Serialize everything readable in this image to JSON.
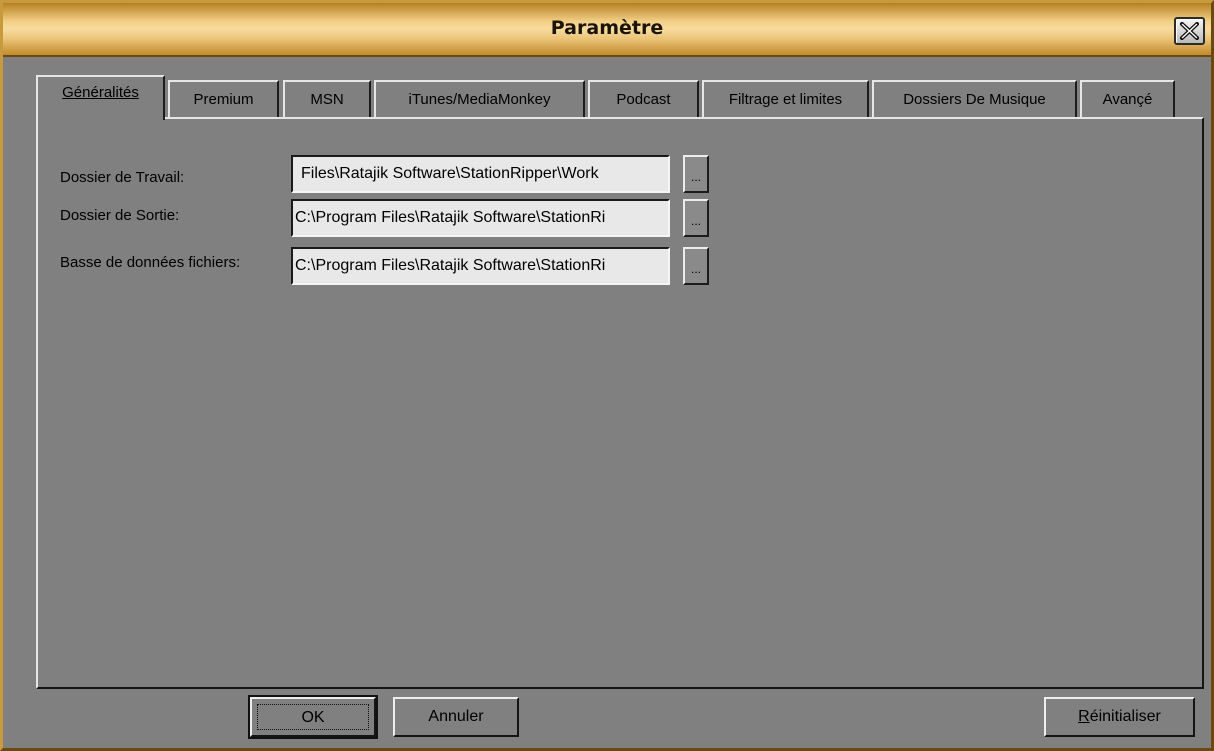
{
  "window": {
    "title": "Paramètre",
    "close_icon": "close-icon"
  },
  "tabs": [
    {
      "label": "Généralités",
      "active": true
    },
    {
      "label": "Premium"
    },
    {
      "label": "MSN"
    },
    {
      "label": "iTunes/MediaMonkey"
    },
    {
      "label": "Podcast"
    },
    {
      "label": "Filtrage et limites"
    },
    {
      "label": "Dossiers De Musique"
    },
    {
      "label": "Avançé"
    }
  ],
  "fields": [
    {
      "label": "Dossier de Travail:",
      "value": "Files\\Ratajik Software\\StationRipper\\Work",
      "button": "..."
    },
    {
      "label": "Dossier de Sortie:",
      "value": "C:\\Program Files\\Ratajik Software\\StationRi",
      "button": "..."
    },
    {
      "label": "Basse de données fichiers:",
      "value": "C:\\Program Files\\Ratajik Software\\StationRi",
      "button": "..."
    }
  ],
  "buttons": {
    "ok": "OK",
    "cancel": "Annuler",
    "reset": "Réinitialiser"
  },
  "colors": {
    "title_gold": "#f2cf86",
    "window_gray": "#808080"
  }
}
